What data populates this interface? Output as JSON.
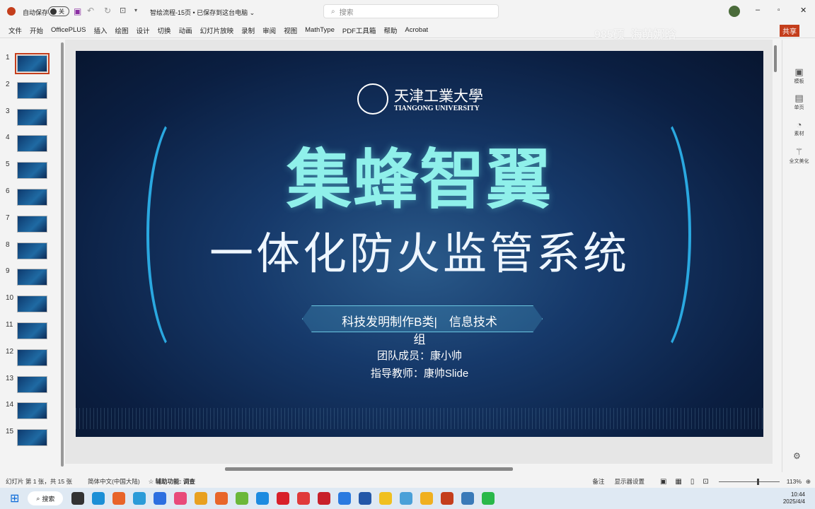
{
  "titlebar": {
    "autosave_label": "自动保存",
    "autosave_state": "关",
    "doc_title": "智绘流程-15页 • 已保存到这台电脑 ⌄",
    "search_placeholder": "搜索"
  },
  "menu": [
    "文件",
    "开始",
    "OfficePLUS",
    "插入",
    "绘图",
    "设计",
    "切换",
    "动画",
    "幻灯片放映",
    "录制",
    "审阅",
    "视图",
    "MathType",
    "PDF工具箱",
    "帮助",
    "Acrobat"
  ],
  "share_label": "共享",
  "watermark": "985硕_海萌娜晗",
  "slides": [
    "1",
    "2",
    "3",
    "4",
    "5",
    "6",
    "7",
    "8",
    "9",
    "10",
    "11",
    "12",
    "13",
    "14",
    "15"
  ],
  "slide": {
    "logo_cn": "天津工業大學",
    "logo_en": "TIANGONG UNIVERSITY",
    "title1": "集蜂智翼",
    "title2": "一体化防火监管系统",
    "banner_line1": "科技发明制作B类|　信息技术",
    "banner_line2": "组",
    "members": "团队成员：康小帅",
    "advisor": "指导教师：康帅Slide"
  },
  "right_panel": [
    "模板",
    "单页",
    "素材",
    "全文美化"
  ],
  "status": {
    "slide_info": "幻灯片 第 1 张，共 15 张",
    "language": "简体中文(中国大陆)",
    "accessibility": "辅助功能: 调查",
    "notes": "备注",
    "display": "显示器设置",
    "zoom": "113%"
  },
  "taskbar": {
    "search": "搜索",
    "time": "10:44",
    "date": "2025/4/4"
  },
  "colors": {
    "accent": "#c43e1c",
    "title": "#8ff0ea"
  }
}
